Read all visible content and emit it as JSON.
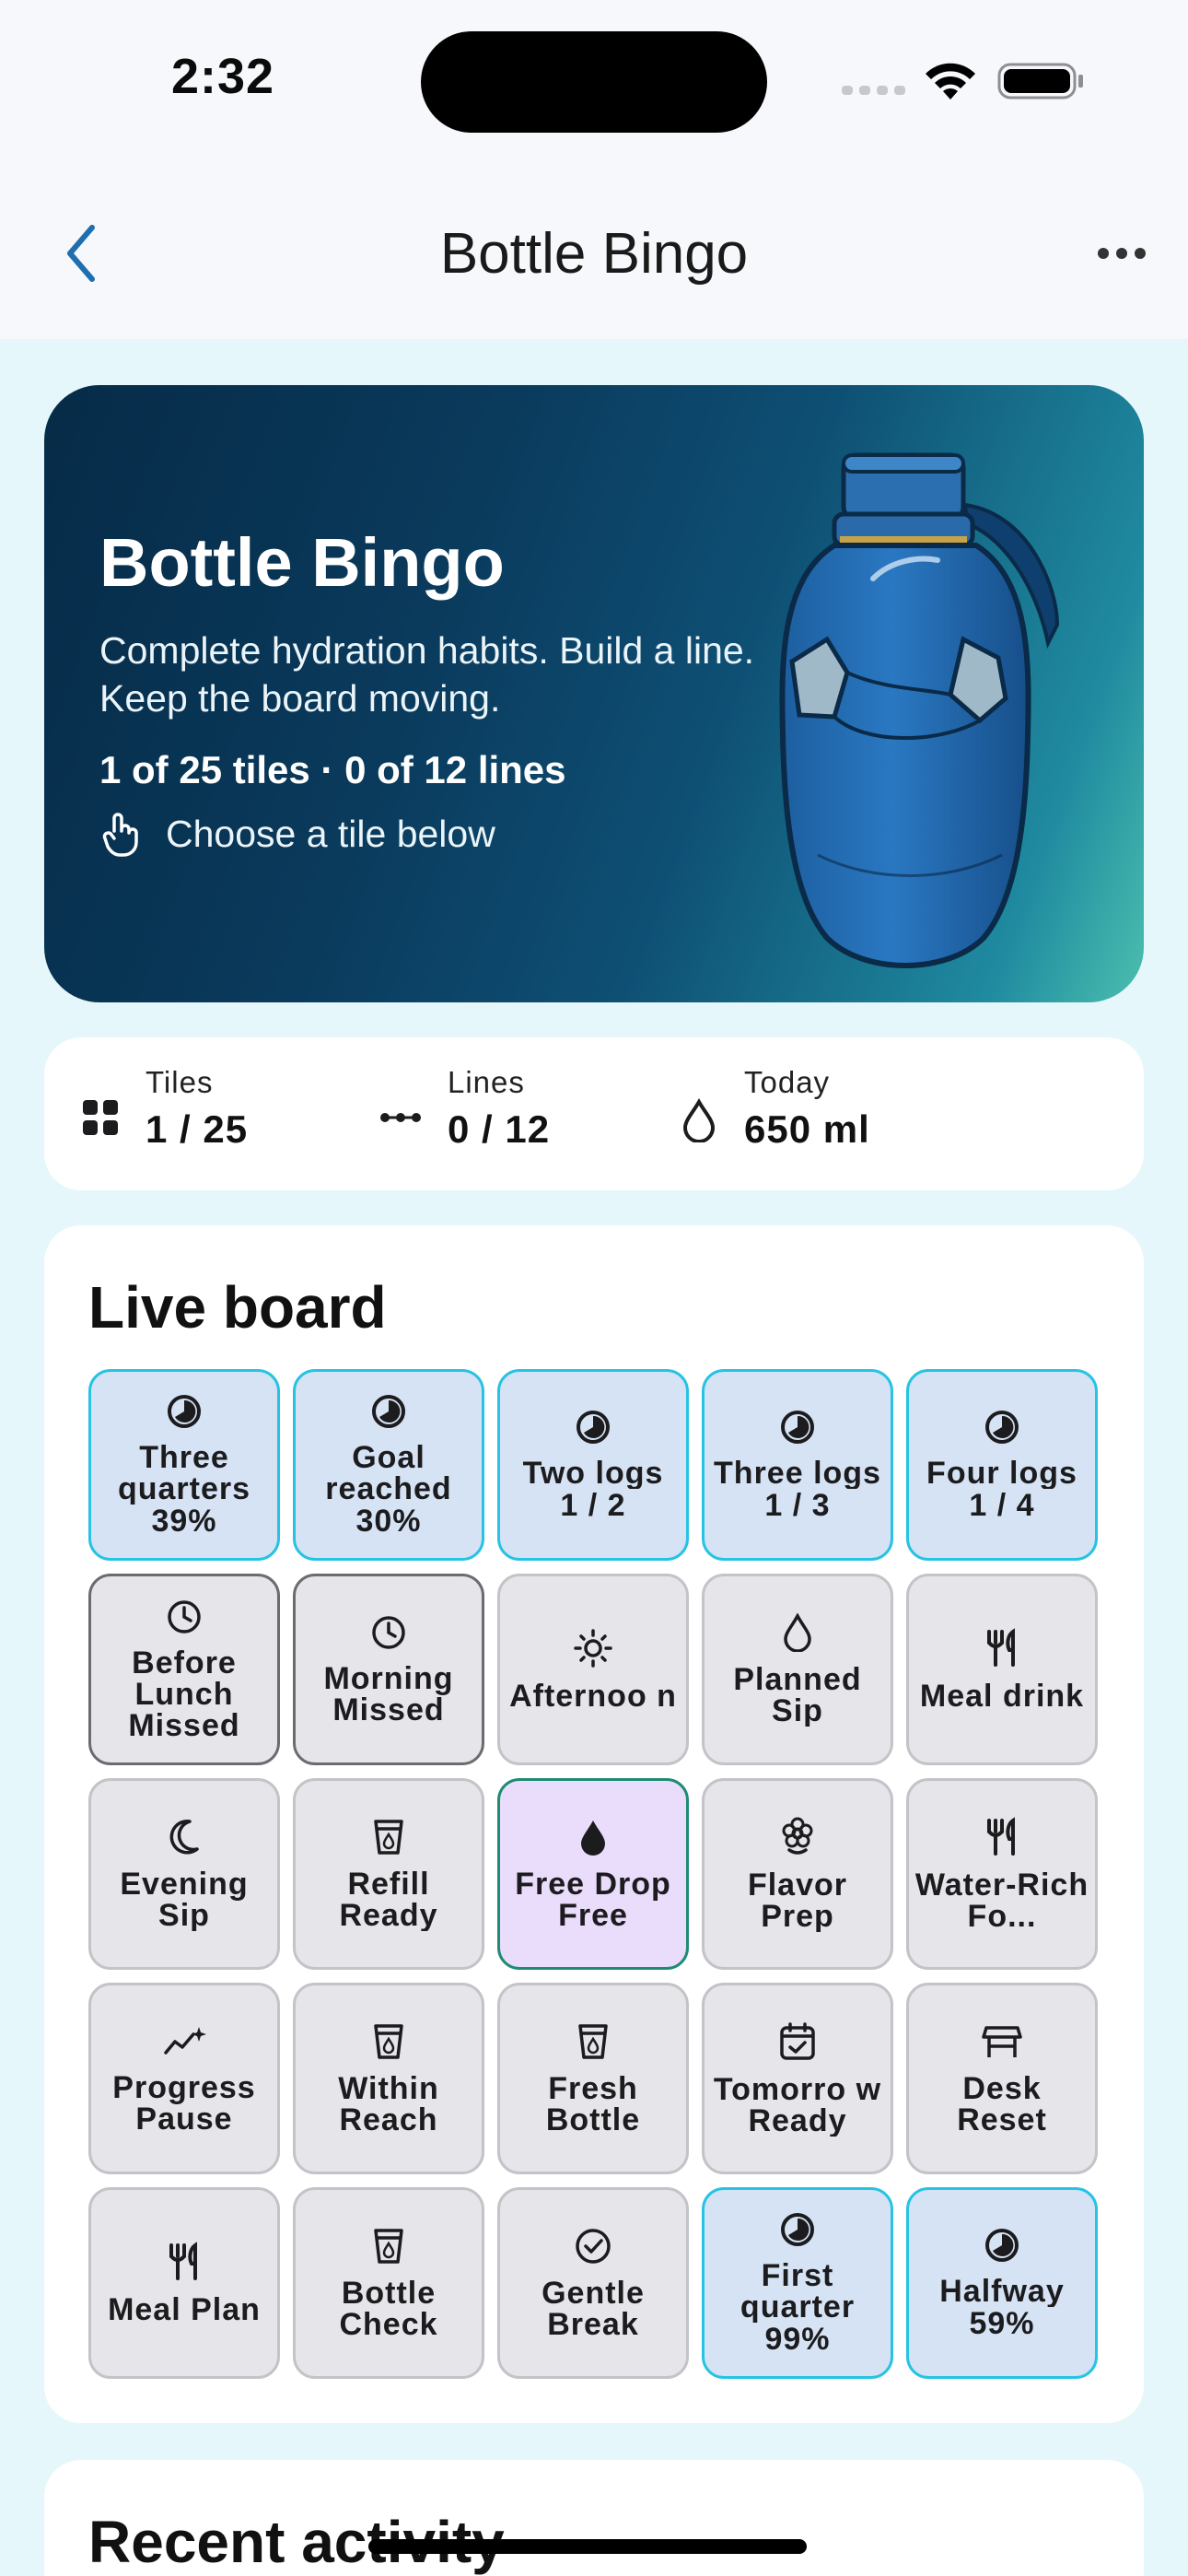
{
  "status": {
    "time": "2:32"
  },
  "nav": {
    "title": "Bottle Bingo"
  },
  "hero": {
    "title": "Bottle Bingo",
    "subtitle": "Complete hydration habits. Build a line. Keep the board moving.",
    "count": "1 of 25 tiles · 0 of 12 lines",
    "hint": "Choose a tile below"
  },
  "stats": [
    {
      "label": "Tiles",
      "value": "1 / 25",
      "icon": "grid-icon"
    },
    {
      "label": "Lines",
      "value": "0 / 12",
      "icon": "line-icon"
    },
    {
      "label": "Today",
      "value": "650 ml",
      "icon": "drop-icon"
    }
  ],
  "board": {
    "title": "Live board",
    "tiles": [
      {
        "label": "Three quarters",
        "sub": "39%",
        "icon": "progress-icon",
        "state": "progress"
      },
      {
        "label": "Goal reached",
        "sub": "30%",
        "icon": "progress-icon",
        "state": "progress"
      },
      {
        "label": "Two logs",
        "sub": "1 / 2",
        "icon": "progress-icon",
        "state": "progress"
      },
      {
        "label": "Three logs",
        "sub": "1 / 3",
        "icon": "progress-icon",
        "state": "progress"
      },
      {
        "label": "Four logs",
        "sub": "1 / 4",
        "icon": "progress-icon",
        "state": "progress"
      },
      {
        "label": "Before Lunch Missed",
        "sub": "",
        "icon": "clock-icon",
        "state": "missed"
      },
      {
        "label": "Morning Missed",
        "sub": "",
        "icon": "clock-icon",
        "state": "missed"
      },
      {
        "label": "Afternoo n",
        "sub": "",
        "icon": "sun-icon",
        "state": "default"
      },
      {
        "label": "Planned Sip",
        "sub": "",
        "icon": "drop-outline-icon",
        "state": "default"
      },
      {
        "label": "Meal drink",
        "sub": "",
        "icon": "utensils-icon",
        "state": "default"
      },
      {
        "label": "Evening Sip",
        "sub": "",
        "icon": "moon-icon",
        "state": "default"
      },
      {
        "label": "Refill Ready",
        "sub": "",
        "icon": "cup-icon",
        "state": "default"
      },
      {
        "label": "Free Drop Free",
        "sub": "",
        "icon": "drop-filled-icon",
        "state": "free"
      },
      {
        "label": "Flavor Prep",
        "sub": "",
        "icon": "flower-icon",
        "state": "default"
      },
      {
        "label": "Water-Rich Fo...",
        "sub": "",
        "icon": "utensils-icon",
        "state": "default"
      },
      {
        "label": "Progress Pause",
        "sub": "",
        "icon": "sparkle-chart-icon",
        "state": "default"
      },
      {
        "label": "Within Reach",
        "sub": "",
        "icon": "cup-icon",
        "state": "default"
      },
      {
        "label": "Fresh Bottle",
        "sub": "",
        "icon": "cup-icon",
        "state": "default"
      },
      {
        "label": "Tomorro w Ready",
        "sub": "",
        "icon": "calendar-check-icon",
        "state": "default"
      },
      {
        "label": "Desk Reset",
        "sub": "",
        "icon": "desk-icon",
        "state": "default"
      },
      {
        "label": "Meal Plan",
        "sub": "",
        "icon": "utensils-icon",
        "state": "default"
      },
      {
        "label": "Bottle Check",
        "sub": "",
        "icon": "cup-icon",
        "state": "default"
      },
      {
        "label": "Gentle Break",
        "sub": "",
        "icon": "check-circle-icon",
        "state": "default"
      },
      {
        "label": "First quarter",
        "sub": "99%",
        "icon": "progress-icon",
        "state": "progress"
      },
      {
        "label": "Halfway",
        "sub": "59%",
        "icon": "progress-icon",
        "state": "progress"
      }
    ]
  },
  "recent": {
    "title": "Recent activity"
  }
}
